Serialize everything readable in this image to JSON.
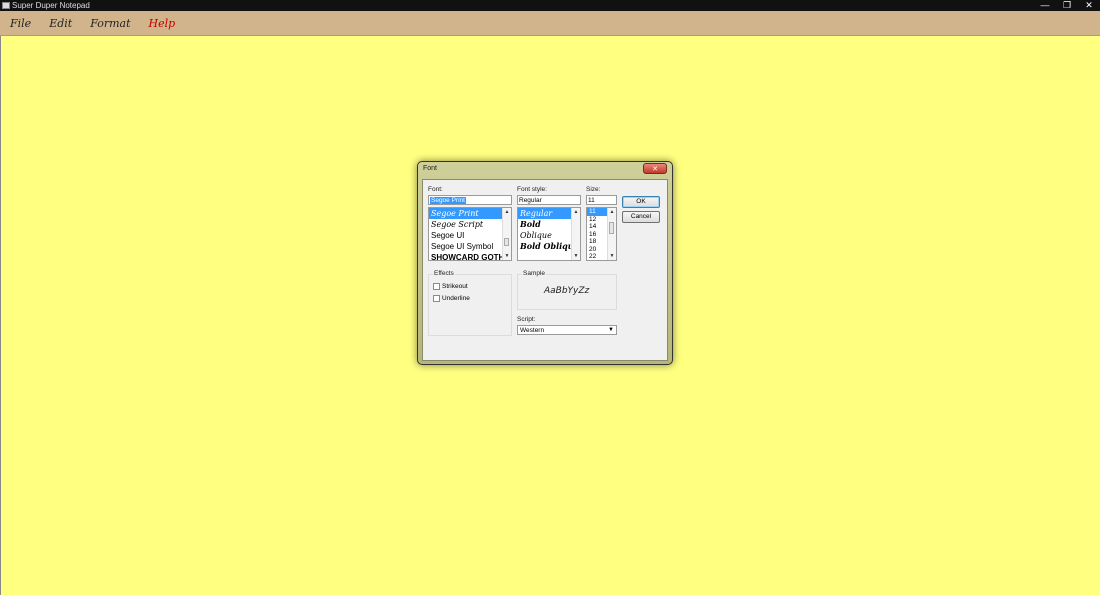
{
  "window": {
    "title": "Super Duper Notepad",
    "controls": [
      "—",
      "❐",
      "✕"
    ]
  },
  "menu": {
    "file": "File",
    "edit": "Edit",
    "format": "Format",
    "help": "Help"
  },
  "dialog": {
    "title": "Font",
    "close": "✕",
    "font_label": "Font:",
    "font_value": "Segoe Print",
    "font_items": [
      "Segoe Print",
      "Segoe Script",
      "Segoe UI",
      "Segoe UI Symbol",
      "SHOWCARD GOTHIC"
    ],
    "style_label": "Font style:",
    "style_value": "Regular",
    "style_items": [
      "Regular",
      "Bold",
      "Oblique",
      "Bold Oblique"
    ],
    "size_label": "Size:",
    "size_value": "11",
    "size_items": [
      "11",
      "12",
      "14",
      "16",
      "18",
      "20",
      "22"
    ],
    "ok": "OK",
    "cancel": "Cancel",
    "effects_label": "Effects",
    "strikeout": "Strikeout",
    "underline": "Underline",
    "sample_label": "Sample",
    "sample_text": "AaBbYyZz",
    "script_label": "Script:",
    "script_value": "Western"
  }
}
